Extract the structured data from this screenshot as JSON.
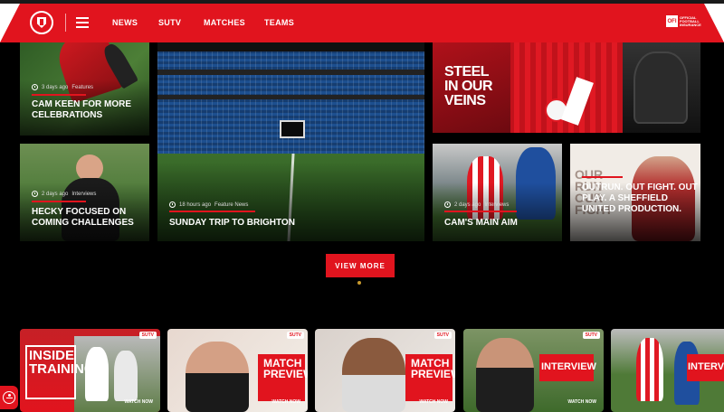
{
  "header": {
    "nav": [
      "NEWS",
      "SUTV",
      "MATCHES",
      "TEAMS"
    ],
    "brand_short": "OFI",
    "brand_text": "OFFICIAL FOOTBALL INSURANCE"
  },
  "colors": {
    "brand_red": "#e1141e",
    "background": "#000000"
  },
  "news": [
    {
      "meta_time": "3 days ago",
      "meta_cat": "Features",
      "title": "CAM KEEN FOR MORE CELEBRATIONS"
    },
    {
      "meta_time": "18 hours ago",
      "meta_cat": "Feature News",
      "title": "SUNDAY TRIP TO BRIGHTON"
    },
    {
      "promo_title": "STEEL IN OUR VEINS"
    },
    {
      "meta_time": "2 days ago",
      "meta_cat": "Interviews",
      "title": "HECKY FOCUSED ON COMING CHALLENGES"
    },
    {
      "meta_time": "2 days ago",
      "meta_cat": "Interviews",
      "title": "CAM'S MAIN AIM"
    },
    {
      "title": "OUTRUN. OUT FIGHT. OUT PLAY. A SHEFFIELD UNITED PRODUCTION.",
      "promo_bg": "OUR RUN OUR FIGHT"
    }
  ],
  "view_more": "VIEW MORE",
  "videos": [
    {
      "label": "INSIDE TRAINING",
      "watch": "WATCH NOW",
      "tag": "SUTV"
    },
    {
      "label": "MATCH PREVIEW",
      "watch": "WATCH NOW",
      "tag": "SUTV"
    },
    {
      "label": "MATCH PREVIEW",
      "watch": "WATCH NOW",
      "tag": "SUTV"
    },
    {
      "label": "INTERVIEW",
      "watch": "WATCH NOW",
      "tag": "SUTV"
    },
    {
      "label": "INTERVIEW",
      "watch": "",
      "tag": ""
    }
  ]
}
